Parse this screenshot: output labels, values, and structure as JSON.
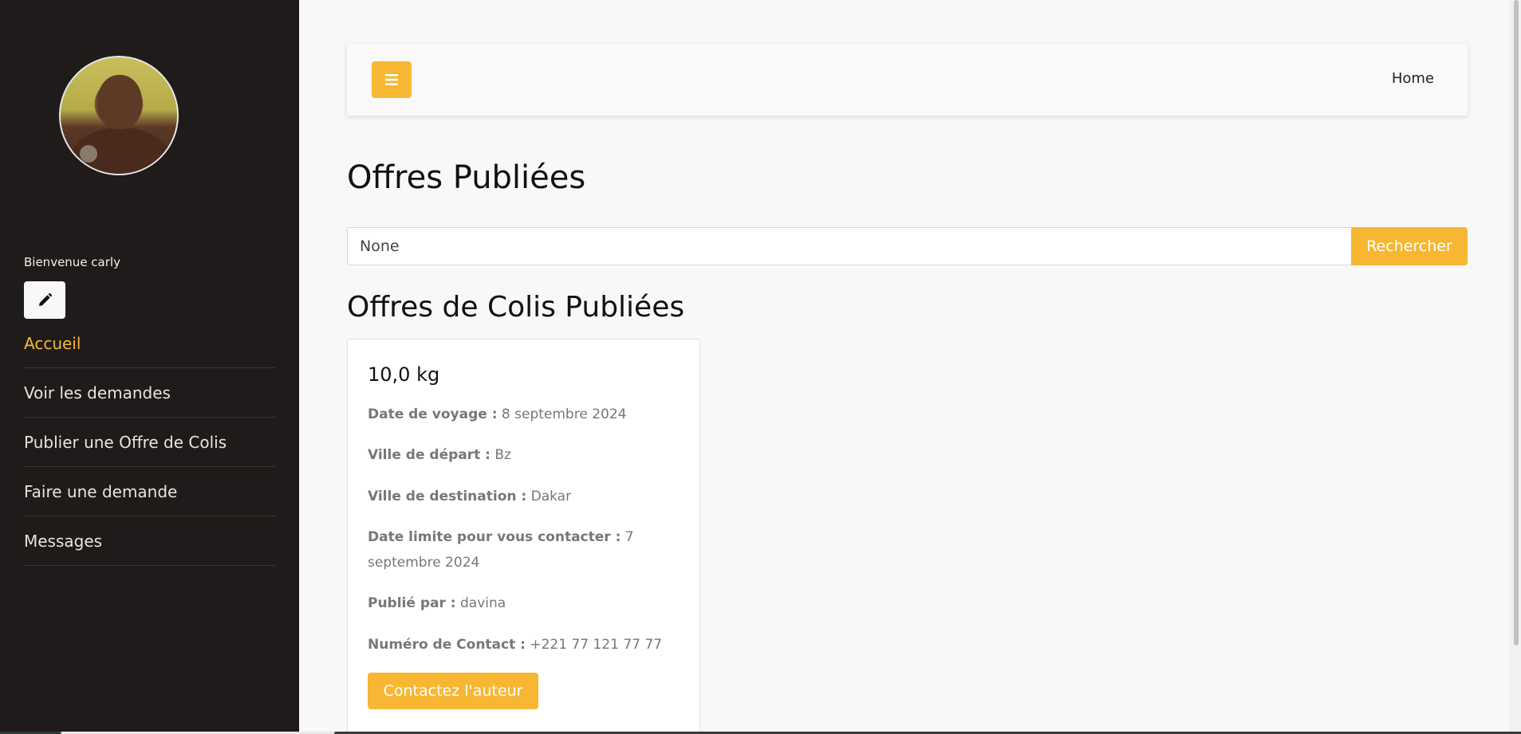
{
  "sidebar": {
    "welcome": "Bienvenue carly",
    "items": [
      {
        "label": "Accueil"
      },
      {
        "label": "Voir les demandes"
      },
      {
        "label": "Publier une Offre de Colis"
      },
      {
        "label": "Faire une demande"
      },
      {
        "label": "Messages"
      }
    ]
  },
  "topbar": {
    "home_link": "Home"
  },
  "page": {
    "title": "Offres Publiées",
    "subtitle": "Offres de Colis Publiées"
  },
  "search": {
    "value": "None",
    "button": "Rechercher"
  },
  "offer": {
    "weight": "10,0 kg",
    "fields": [
      {
        "label": "Date de voyage :",
        "value": "8 septembre 2024"
      },
      {
        "label": "Ville de départ :",
        "value": "Bz"
      },
      {
        "label": "Ville de destination :",
        "value": "Dakar"
      },
      {
        "label": "Date limite pour vous contacter :",
        "value": "7 septembre 2024"
      },
      {
        "label": "Publié par :",
        "value": "davina"
      },
      {
        "label": "Numéro de Contact :",
        "value": "+221 77 121 77 77"
      }
    ],
    "contact_button": "Contactez l'auteur"
  },
  "colors": {
    "accent": "#f7b733",
    "sidebar_bg": "#1f1b1a",
    "page_bg": "#f8f8f8"
  },
  "icons": {
    "edit": "pencil-icon",
    "menu": "bars-icon"
  }
}
